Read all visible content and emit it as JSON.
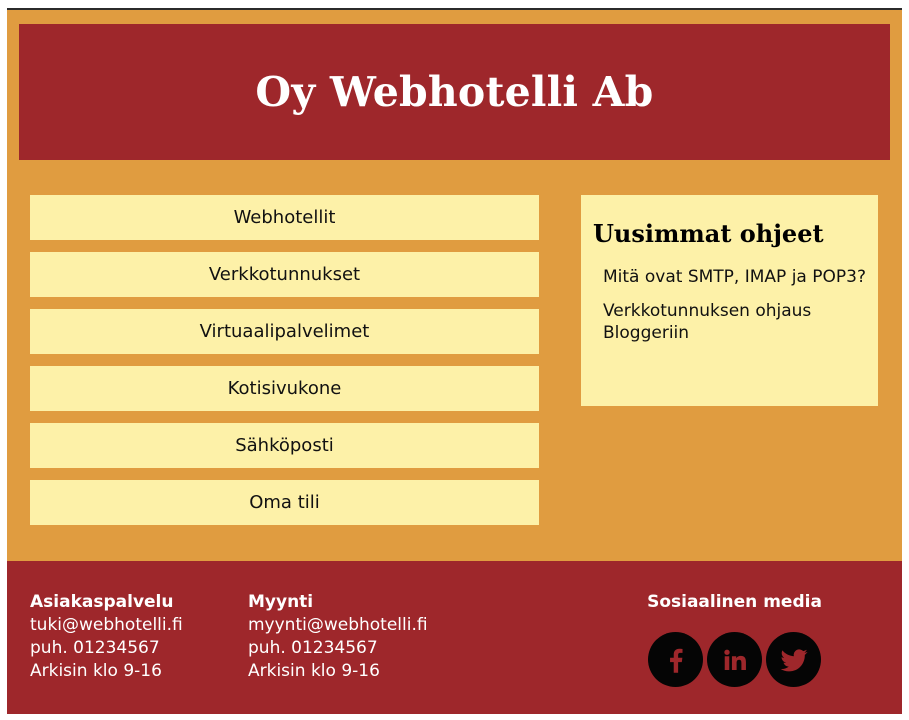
{
  "header": {
    "title": "Oy Webhotelli Ab"
  },
  "nav": {
    "items": [
      "Webhotellit",
      "Verkkotunnukset",
      "Virtuaalipalvelimet",
      "Kotisivukone",
      "Sähköposti",
      "Oma tili"
    ]
  },
  "news": {
    "title": "Uusimmat ohjeet",
    "items": [
      "Mitä ovat SMTP, IMAP ja POP3?",
      "Verkkotunnuksen ohjaus Bloggeriin"
    ]
  },
  "footer": {
    "customer_service": {
      "title": "Asiakaspalvelu",
      "email": "tuki@webhotelli.fi",
      "phone": "puh. 01234567",
      "hours": "Arkisin klo 9-16"
    },
    "sales": {
      "title": "Myynti",
      "email": "myynti@webhotelli.fi",
      "phone": "puh. 01234567",
      "hours": "Arkisin klo 9-16"
    },
    "social": {
      "title": "Sosiaalinen media",
      "icons": [
        "facebook-icon",
        "linkedin-icon",
        "twitter-icon"
      ]
    }
  },
  "colors": {
    "background": "#e09c40",
    "header": "#9e272b",
    "panel": "#fdf1a8"
  }
}
